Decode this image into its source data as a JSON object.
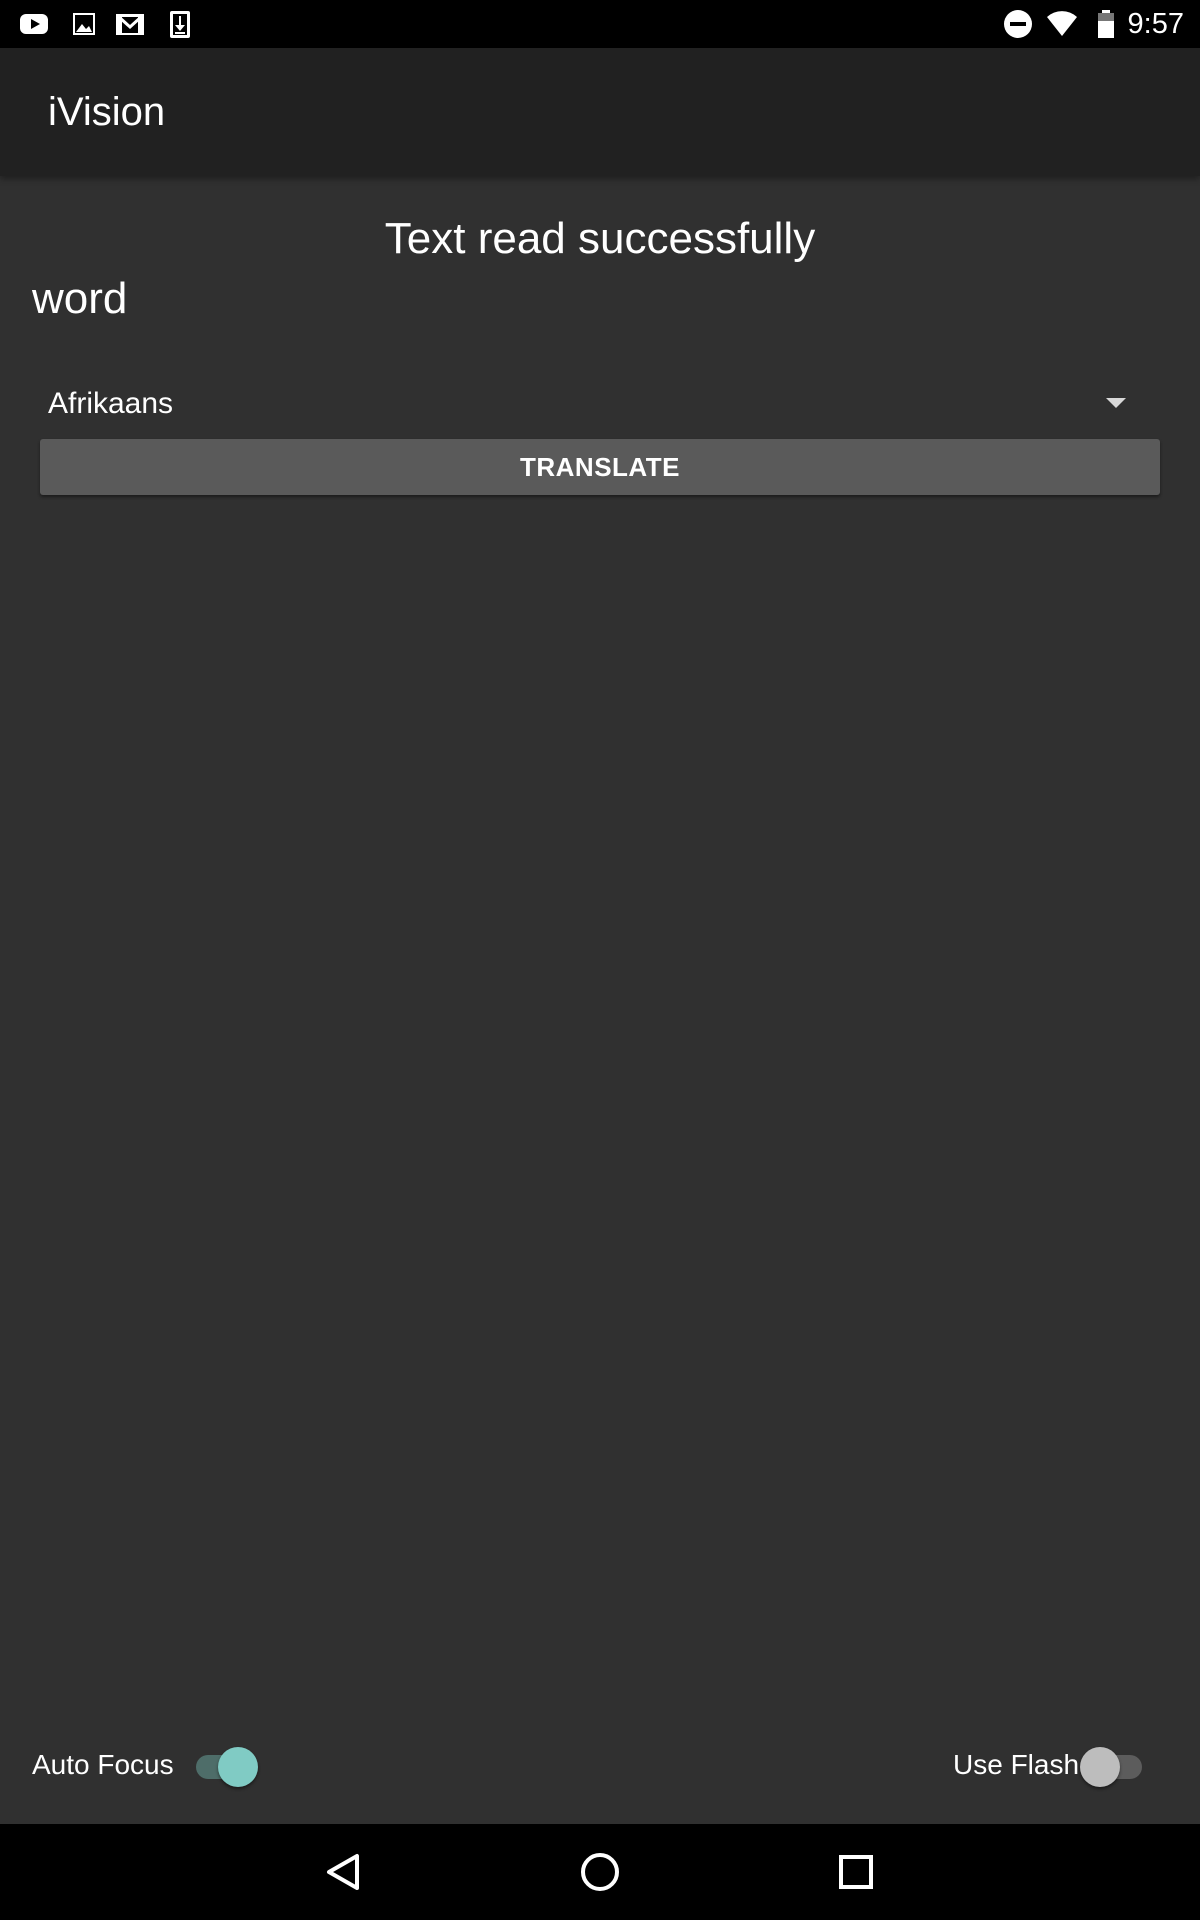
{
  "status_bar": {
    "time": "9:57",
    "left_icons": [
      "youtube-icon",
      "image-icon",
      "gmail-icon",
      "download-icon"
    ],
    "right_icons": [
      "do-not-disturb-icon",
      "wifi-icon",
      "battery-icon"
    ]
  },
  "app_bar": {
    "title": "iVision"
  },
  "main": {
    "status_message": "Text read successfully",
    "recognized_text": "word",
    "language_spinner": {
      "selected": "Afrikaans"
    },
    "translate_button": "TRANSLATE"
  },
  "controls": {
    "auto_focus": {
      "label": "Auto Focus",
      "checked": true
    },
    "use_flash": {
      "label": "Use Flash",
      "checked": false
    }
  },
  "nav_bar": {
    "buttons": [
      "back-icon",
      "home-icon",
      "recents-icon"
    ]
  },
  "colors": {
    "background": "#303030",
    "app_bar": "#212121",
    "button": "#5a5a5a",
    "switch_accent": "#80cbc4"
  }
}
